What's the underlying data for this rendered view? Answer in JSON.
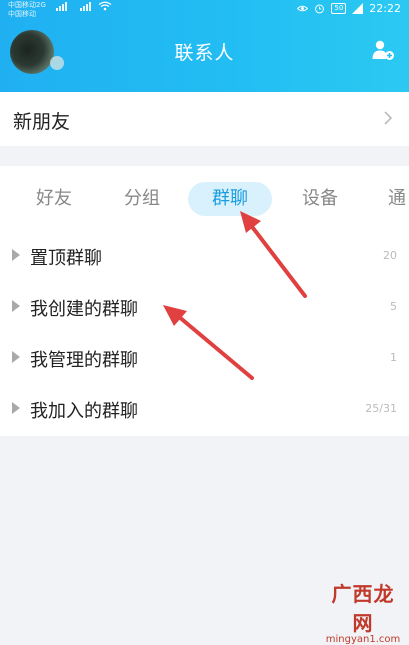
{
  "status_bar": {
    "carrier_line1": "中国移动2G",
    "carrier_line2": "中国移动",
    "battery": "50",
    "time": "22:22"
  },
  "header": {
    "title": "联系人",
    "add_icon": "add-contact-icon"
  },
  "new_friends": {
    "label": "新朋友",
    "icon": "chevron-right-icon"
  },
  "tabs": [
    {
      "label": "好友"
    },
    {
      "label": "分组"
    },
    {
      "label": "群聊"
    },
    {
      "label": "设备"
    },
    {
      "label": "通"
    }
  ],
  "active_tab": "群聊",
  "groups": [
    {
      "label": "置顶群聊",
      "count": "20"
    },
    {
      "label": "我创建的群聊",
      "count": "5"
    },
    {
      "label": "我管理的群聊",
      "count": "1"
    },
    {
      "label": "我加入的群聊",
      "count": "25/31"
    }
  ],
  "watermark": {
    "brand": "广西龙网",
    "url": "mingyan1.com"
  },
  "colors": {
    "header": "#22bdf3",
    "active_tab_bg": "#d9f1fd",
    "active_tab_text": "#1a9de0",
    "annotation_arrow": "#e0403f"
  }
}
